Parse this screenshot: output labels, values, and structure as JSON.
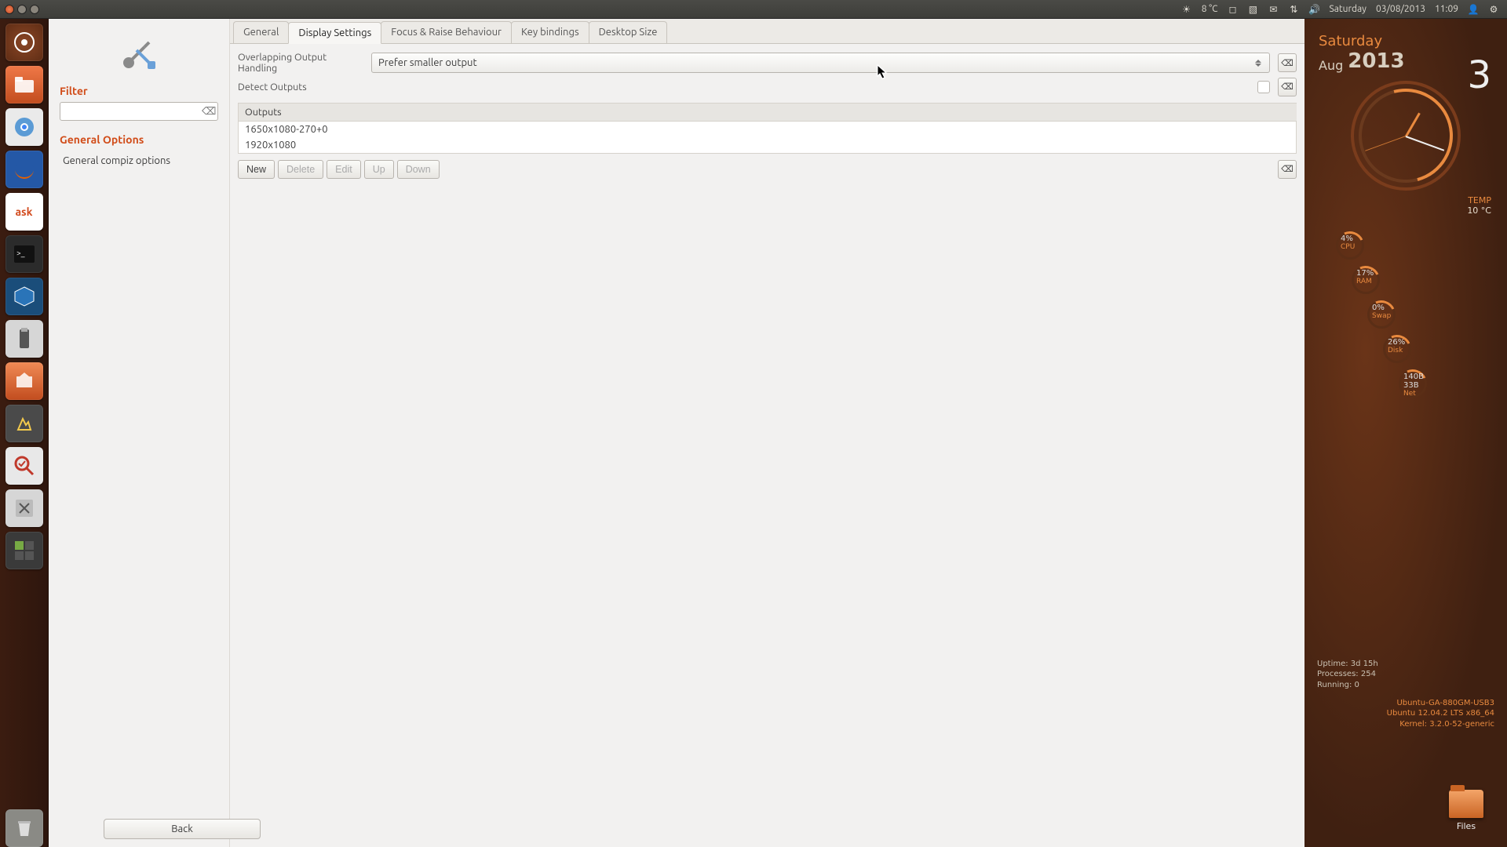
{
  "panel": {
    "weather": "8 °C",
    "day": "Saturday",
    "date": "03/08/2013",
    "time": "11:09"
  },
  "sidebar": {
    "filter_heading": "Filter",
    "filter_value": "",
    "general_heading": "General Options",
    "general_item": "General compiz options",
    "back_label": "Back"
  },
  "tabs": {
    "general": "General",
    "display": "Display Settings",
    "focus": "Focus & Raise Behaviour",
    "key": "Key bindings",
    "desktop": "Desktop Size"
  },
  "form": {
    "overlap_label": "Overlapping Output Handling",
    "overlap_value": "Prefer smaller output",
    "detect_label": "Detect Outputs",
    "outputs_header": "Outputs",
    "outputs": [
      "1650x1080-270+0",
      "1920x1080"
    ],
    "buttons": {
      "new": "New",
      "delete": "Delete",
      "edit": "Edit",
      "up": "Up",
      "down": "Down"
    }
  },
  "conky": {
    "dow": "Saturday",
    "month": "Aug",
    "year": "2013",
    "daynum": "3",
    "temp_label": "TEMP",
    "temp_value": "10 °C",
    "metrics": {
      "cpu": {
        "v": "4%",
        "n": "CPU"
      },
      "ram": {
        "v": "17%",
        "n": "RAM"
      },
      "swap": {
        "v": "0%",
        "n": "Swap"
      },
      "disk": {
        "v": "26%",
        "n": "Disk"
      },
      "net": {
        "v": "140B",
        "v2": "33B",
        "n": "Net"
      }
    },
    "uptime": "Uptime: 3d 15h",
    "procs": "Processes: 254",
    "running": "Running: 0",
    "host": "Ubuntu-GA-880GM-USB3",
    "os": "Ubuntu 12.04.2 LTS  x86_64",
    "kernel": "Kernel: 3.2.0-52-generic",
    "files_label": "Files"
  }
}
